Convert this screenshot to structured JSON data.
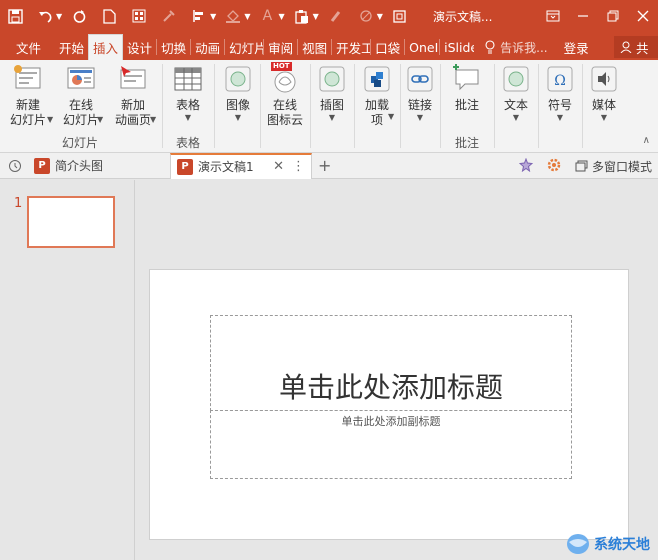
{
  "title_bar": {
    "document_title": "演示文稿..."
  },
  "tabs": [
    "文件",
    "开始",
    "插入",
    "设计",
    "切换",
    "动画",
    "幻灯片",
    "审阅",
    "视图",
    "开发",
    "口袋",
    "OneN",
    "iSlide"
  ],
  "tabs_display": [
    "文件",
    "开始",
    "插入",
    "设计",
    "切换",
    "动画",
    "幻灯片",
    "审阅",
    "视图",
    "开发工",
    "口袋",
    "OneI",
    "iSlide"
  ],
  "tell_me": "告诉我...",
  "login": "登录",
  "share": "共",
  "ribbon": {
    "new_slide": [
      "新建",
      "幻灯片"
    ],
    "online_slide": [
      "在线",
      "幻灯片"
    ],
    "new_anim_page": [
      "新加",
      "动画页"
    ],
    "group_slides": "幻灯片",
    "table": "表格",
    "group_table": "表格",
    "image": "图像",
    "online_icon": [
      "在线",
      "图标云"
    ],
    "hot": "HOT",
    "illustration": "插图",
    "addin": [
      "加载",
      "项"
    ],
    "link": "链接",
    "comment": "批注",
    "group_comment": "批注",
    "text": "文本",
    "symbol": "符号",
    "media": "媒体"
  },
  "doc_tabs": {
    "first": "简介头图",
    "active": "演示文稿1",
    "multi_window": "多窗口模式"
  },
  "slide": {
    "number": "1",
    "title_placeholder": "单击此处添加标题",
    "subtitle_placeholder": "单击此处添加副标题"
  },
  "watermark": "系统天地",
  "colors": {
    "accent": "#c9472a",
    "active_tab_text": "#c9472a",
    "thumb_border": "#e07856"
  }
}
